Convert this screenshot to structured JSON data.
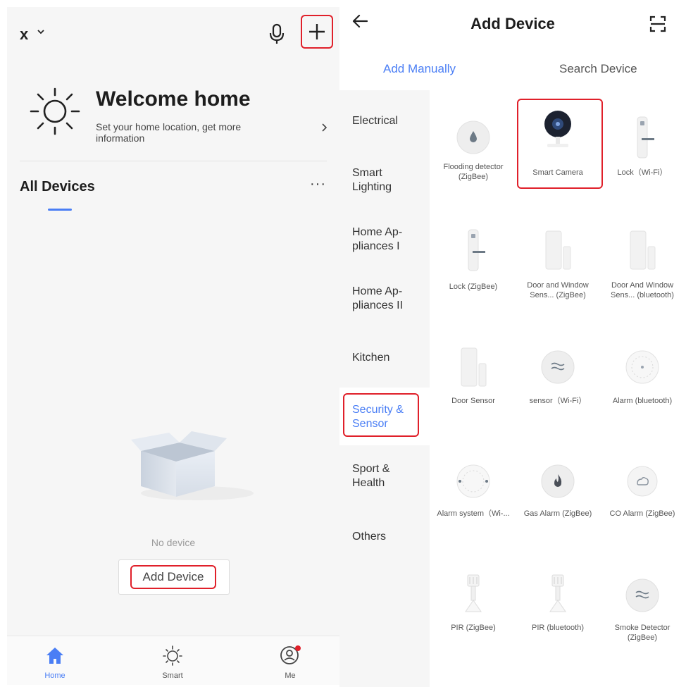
{
  "left": {
    "home_name": "x",
    "welcome_title": "Welcome home",
    "welcome_sub": "Set your home location, get more information",
    "section_title": "All Devices",
    "more_label": "···",
    "empty_text": "No device",
    "add_device_label": "Add Device",
    "nav": [
      {
        "label": "Home",
        "icon": "home-icon"
      },
      {
        "label": "Smart",
        "icon": "sun-icon"
      },
      {
        "label": "Me",
        "icon": "profile-icon"
      }
    ]
  },
  "right": {
    "title": "Add Device",
    "tabs": [
      "Add Manually",
      "Search Device"
    ],
    "categories": [
      "Electrical",
      "Smart Lighting",
      "Home Ap-pliances I",
      "Home Ap-pliances II",
      "Kitchen",
      "Security & Sensor",
      "Sport & Health",
      "Others"
    ],
    "active_category": "Security & Sensor",
    "devices": [
      {
        "label": "Flooding detector (ZigBee)",
        "icon": "flood-sensor-icon"
      },
      {
        "label": "Smart Camera",
        "icon": "camera-icon"
      },
      {
        "label": "Lock（Wi-Fi）",
        "icon": "lock-icon"
      },
      {
        "label": "Lock (ZigBee)",
        "icon": "lock-icon"
      },
      {
        "label": "Door and Window Sens... (ZigBee)",
        "icon": "door-sensor-icon"
      },
      {
        "label": "Door And Window Sens... (bluetooth)",
        "icon": "door-sensor-icon"
      },
      {
        "label": "Door Sensor",
        "icon": "door-sensor-icon"
      },
      {
        "label": "sensor（Wi-Fi）",
        "icon": "sensor-icon"
      },
      {
        "label": "Alarm (bluetooth)",
        "icon": "alarm-icon"
      },
      {
        "label": "Alarm system（Wi-...",
        "icon": "alarm-icon"
      },
      {
        "label": "Gas Alarm (ZigBee)",
        "icon": "gas-alarm-icon"
      },
      {
        "label": "CO Alarm (ZigBee)",
        "icon": "co-alarm-icon"
      },
      {
        "label": "PIR (ZigBee)",
        "icon": "pir-icon"
      },
      {
        "label": "PIR (bluetooth)",
        "icon": "pir-icon"
      },
      {
        "label": "Smoke Detector (ZigBee)",
        "icon": "smoke-detector-icon"
      }
    ]
  },
  "colors": {
    "accent": "#4a7ef5",
    "highlight": "#e0202a",
    "notification_dot": "#e0202a"
  }
}
